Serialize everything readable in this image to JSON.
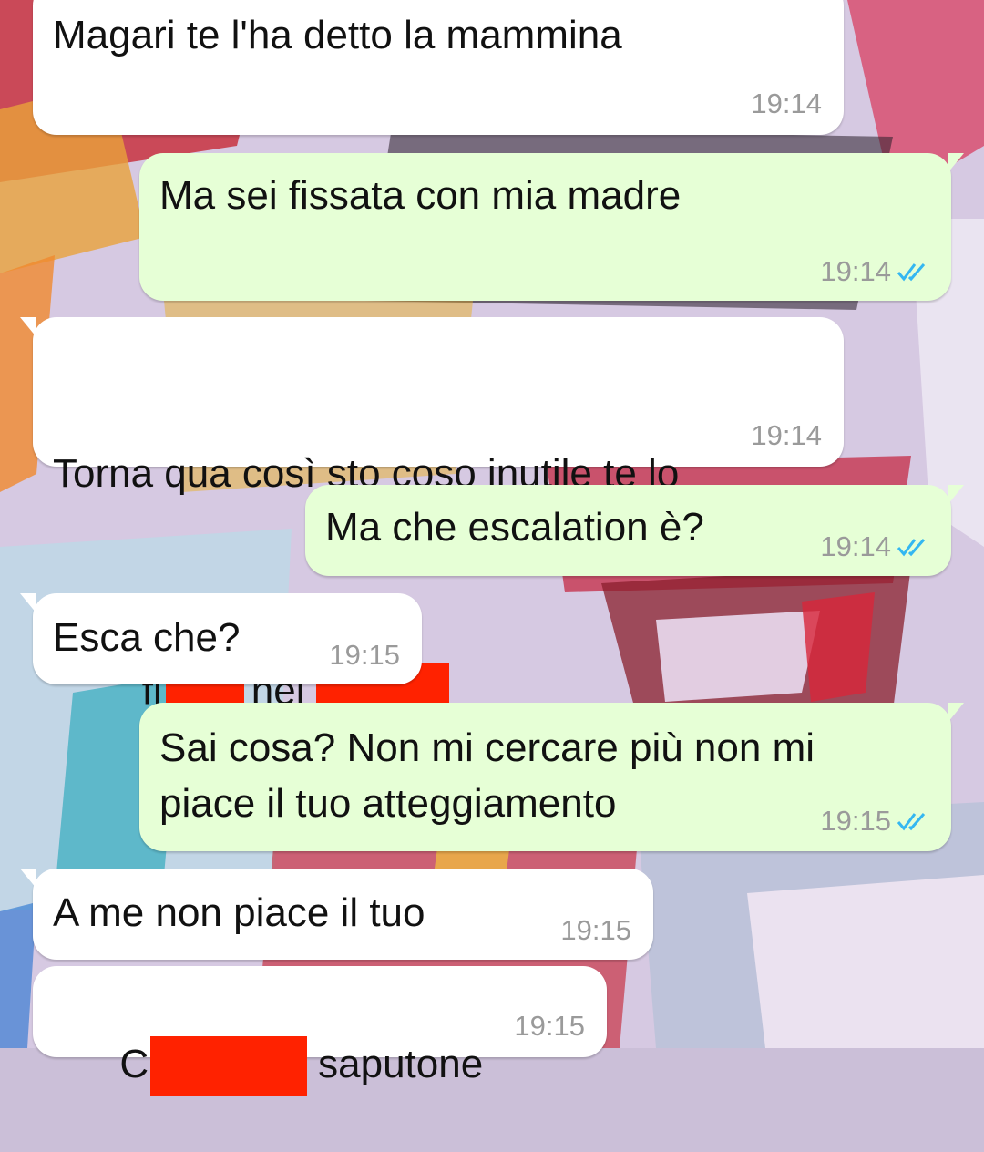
{
  "colors": {
    "incoming_bubble": "#ffffff",
    "outgoing_bubble": "#e6ffd6",
    "timestamp": "#9a9a9a",
    "read_ticks": "#34b7f1",
    "redaction": "#ff2200"
  },
  "messages": [
    {
      "direction": "incoming",
      "text": "Magari te l'ha detto la mammina",
      "time": "19:14"
    },
    {
      "direction": "outgoing",
      "text": "Ma sei fissata con mia madre",
      "time": "19:14",
      "status": "read-ticks-icon"
    },
    {
      "direction": "incoming",
      "line1": "Torna qua così sto coso inutile te lo",
      "line2_prefix": "fi",
      "line2_mid": "nel",
      "time": "19:14",
      "redacted": true
    },
    {
      "direction": "outgoing",
      "text": "Ma che escalation è?",
      "time": "19:14",
      "status": "read-ticks-icon"
    },
    {
      "direction": "incoming",
      "text": "Esca che?",
      "time": "19:15"
    },
    {
      "direction": "outgoing",
      "text": "Sai cosa? Non mi cercare più non mi\npiace il tuo atteggiamento",
      "time": "19:15",
      "status": "read-ticks-icon"
    },
    {
      "direction": "incoming",
      "text": "A me non piace il tuo",
      "time": "19:15"
    },
    {
      "direction": "incoming",
      "prefix": "C",
      "suffix": "saputone",
      "time": "19:15",
      "redacted": true
    }
  ]
}
